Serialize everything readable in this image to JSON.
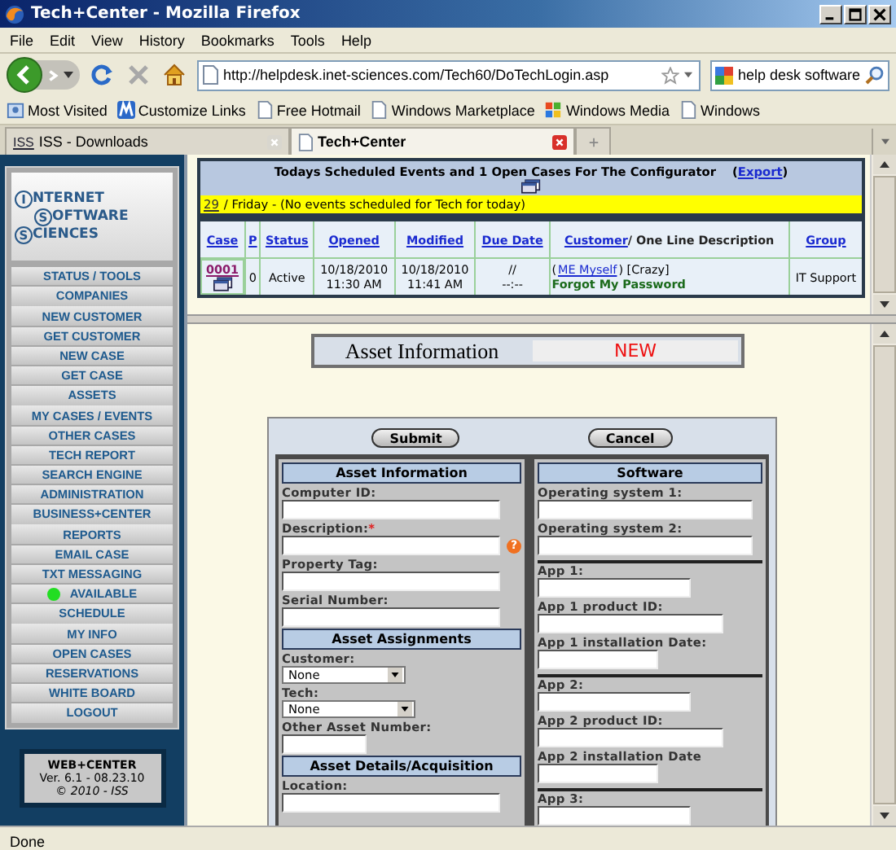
{
  "window": {
    "title": "Tech+Center - Mozilla Firefox"
  },
  "menu": [
    "File",
    "Edit",
    "View",
    "History",
    "Bookmarks",
    "Tools",
    "Help"
  ],
  "toolbar": {
    "url": "http://helpdesk.inet-sciences.com/Tech60/DoTechLogin.asp",
    "search_value": "help desk software"
  },
  "bookmarks": [
    {
      "label": "Most Visited",
      "kind": "folder"
    },
    {
      "label": "Customize Links",
      "kind": "logo"
    },
    {
      "label": "Free Hotmail",
      "kind": "page"
    },
    {
      "label": "Windows Marketplace",
      "kind": "page"
    },
    {
      "label": "Windows Media",
      "kind": "flag"
    },
    {
      "label": "Windows",
      "kind": "page"
    }
  ],
  "tabs": [
    {
      "label": "ISS - Downloads",
      "selected": false,
      "icon_text": "ISS"
    },
    {
      "label": "Tech+Center",
      "selected": true
    }
  ],
  "sidebar": {
    "logo": [
      {
        "initial": "I",
        "rest": "NTERNET"
      },
      {
        "initial": "S",
        "rest": "OFTWARE"
      },
      {
        "initial": "S",
        "rest": "CIENCES"
      }
    ],
    "items": [
      {
        "label": "STATUS / TOOLS",
        "kind": "link"
      },
      {
        "label": "COMPANIES",
        "kind": "link"
      },
      {
        "label": "NEW CUSTOMER",
        "kind": "link"
      },
      {
        "label": "GET CUSTOMER",
        "kind": "link"
      },
      {
        "label": "NEW CASE",
        "kind": "link"
      },
      {
        "label": "GET CASE",
        "kind": "link"
      },
      {
        "label": "ASSETS",
        "kind": "link"
      },
      {
        "label": "MY CASES / EVENTS",
        "kind": "link"
      },
      {
        "label": "OTHER CASES",
        "kind": "link"
      },
      {
        "label": "TECH REPORT",
        "kind": "link"
      },
      {
        "label": "SEARCH ENGINE",
        "kind": "link"
      },
      {
        "label": "ADMINISTRATION",
        "kind": "link"
      },
      {
        "label": "BUSINESS+CENTER",
        "kind": "link"
      },
      {
        "label": "REPORTS",
        "kind": "link"
      },
      {
        "label": "EMAIL CASE",
        "kind": "link"
      },
      {
        "label": "TXT MESSAGING",
        "kind": "link"
      },
      {
        "label": "AVAILABLE",
        "kind": "status",
        "color": "#22dd22"
      },
      {
        "label": "SCHEDULE",
        "kind": "link"
      },
      {
        "label": "MY INFO",
        "kind": "link"
      },
      {
        "label": "OPEN CASES",
        "kind": "link"
      },
      {
        "label": "RESERVATIONS",
        "kind": "link"
      },
      {
        "label": "WHITE BOARD",
        "kind": "link"
      },
      {
        "label": "LOGOUT",
        "kind": "link"
      }
    ],
    "footer": {
      "title": "WEB+CENTER",
      "version": "Ver. 6.1 - 08.23.10",
      "copyright": "© 2010 - ISS"
    }
  },
  "events": {
    "title": "Todays Scheduled Events and 1  Open Cases For  The Configurator",
    "export_prefix": "(",
    "export_link": "Export",
    "export_suffix": ")",
    "day_link": "29",
    "day_text": "/ Friday - (No events scheduled for Tech for today)",
    "columns": [
      {
        "label": "Case"
      },
      {
        "label": "P"
      },
      {
        "label": "Status"
      },
      {
        "label": "Opened"
      },
      {
        "label": "Modified"
      },
      {
        "label": "Due Date"
      },
      {
        "label": "Customer",
        "suffix": "/ One Line Description"
      },
      {
        "label": "Group"
      }
    ],
    "rows": [
      {
        "case": "0001",
        "p": "0",
        "status": "Active",
        "opened": [
          "10/18/2010",
          "11:30 AM"
        ],
        "modified": [
          "10/18/2010",
          "11:41 AM"
        ],
        "due": [
          "//",
          "--:--"
        ],
        "customer_prefix": "(",
        "customer": "ME Myself",
        "tag": ") [Crazy]",
        "description": "Forgot My Password",
        "group": "IT Support"
      }
    ]
  },
  "asset": {
    "header": "Asset Information",
    "status": "NEW",
    "buttons": [
      "Submit",
      "Cancel"
    ],
    "left": [
      {
        "title": "Asset Information",
        "groups": [
          [
            {
              "label": "Computer ID:",
              "kind": "text"
            },
            {
              "label": "Description:",
              "kind": "text",
              "required_mark": "*",
              "help": "?"
            },
            {
              "label": "Property Tag:",
              "kind": "text"
            },
            {
              "label": "Serial Number:",
              "kind": "text"
            }
          ]
        ]
      },
      {
        "title": "Asset Assignments",
        "groups": [
          [
            {
              "label": "Customer:",
              "kind": "select",
              "value": "None"
            },
            {
              "label": "Tech:",
              "kind": "select",
              "value": "None"
            },
            {
              "label": "Other Asset Number:",
              "kind": "text"
            }
          ]
        ]
      },
      {
        "title": "Asset Details/Acquisition",
        "groups": [
          [
            {
              "label": "Location:",
              "kind": "text"
            }
          ]
        ]
      }
    ],
    "right": [
      {
        "title": "Software",
        "groups": [
          [
            {
              "label": "Operating system 1:",
              "kind": "text"
            },
            {
              "label": "Operating system 2:",
              "kind": "text"
            }
          ],
          [
            {
              "label": "App 1:",
              "kind": "text"
            },
            {
              "label": "App 1 product ID:",
              "kind": "text"
            },
            {
              "label": "App 1 installation Date:",
              "kind": "text"
            }
          ],
          [
            {
              "label": "App 2:",
              "kind": "text"
            },
            {
              "label": "App 2 product ID:",
              "kind": "text"
            },
            {
              "label": "App 2 installation Date",
              "kind": "text"
            }
          ],
          [
            {
              "label": "App 3:",
              "kind": "text"
            }
          ]
        ]
      }
    ]
  },
  "status_bar": "Done"
}
